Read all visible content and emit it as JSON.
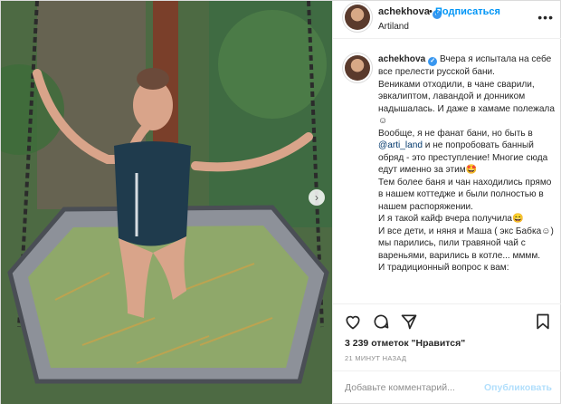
{
  "post": {
    "username": "achekhova",
    "follow_label": "Подписаться",
    "dot": "•",
    "location": "Artiland",
    "more_label": "•••",
    "next_arrow": "›",
    "caption": {
      "lines": [
        "Вчера я испытала на себе все прелести русской бани.",
        "Вениками отходили, в чане сварили, эвкалиптом, лавандой и донником надышалась. И даже в хамаме полежала☺",
        "Вообще, я не фанат бани, но быть в",
        "и не попробовать банный обряд - это преступление! Многие сюда едут именно за этим🤩",
        "Тем более баня и чан находились прямо в нашем коттедже и были полностью в нашем распоряжении.",
        "И я такой кайф вчера получила😄",
        "И все дети, и няня и Маша ( экс Бабка☺) мы парились, пили травяной чай с вареньями, варились в котле... мммм.",
        "И традиционный вопрос к вам:"
      ],
      "mention": "@arti_land"
    },
    "likes": "3 239 отметок \"Нравится\"",
    "time": "21 минут назад",
    "comment_placeholder": "Добавьте комментарий...",
    "publish_label": "Опубликовать"
  },
  "icons": {
    "verified": "verified-badge-icon",
    "like": "heart-icon",
    "comment": "comment-bubble-icon",
    "share": "paper-plane-icon",
    "save": "bookmark-icon"
  },
  "colors": {
    "accent": "#0095f6",
    "publish_disabled": "#b2dffc",
    "text": "#262626",
    "muted": "#8e8e8e",
    "verified": "#3897f0"
  }
}
